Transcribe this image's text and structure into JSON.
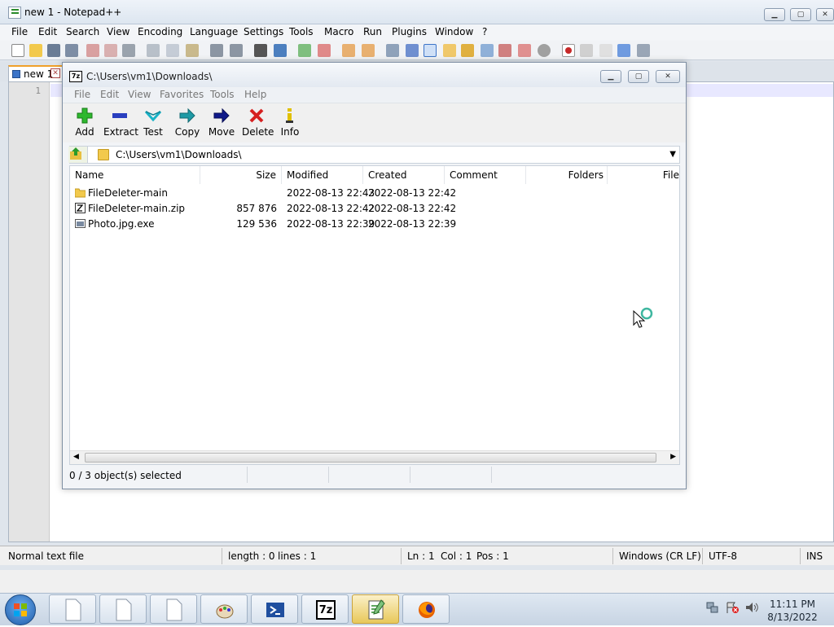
{
  "npp": {
    "title": "new 1 - Notepad++",
    "menu": [
      "File",
      "Edit",
      "Search",
      "View",
      "Encoding",
      "Language",
      "Settings",
      "Tools",
      "Macro",
      "Run",
      "Plugins",
      "Window",
      "?"
    ],
    "tab_label": "new 1",
    "line_number": "1",
    "status": {
      "type": "Normal text file",
      "length": "length : 0",
      "lines": "lines : 1",
      "ln": "Ln : 1",
      "col": "Col : 1",
      "pos": "Pos : 1",
      "eol": "Windows (CR LF)",
      "encoding": "UTF-8",
      "mode": "INS"
    }
  },
  "sevenzip": {
    "title": "C:\\Users\\vm1\\Downloads\\",
    "icon_text": "7z",
    "menu": [
      "File",
      "Edit",
      "View",
      "Favorites",
      "Tools",
      "Help"
    ],
    "toolbar": {
      "add": "Add",
      "extract": "Extract",
      "test": "Test",
      "copy": "Copy",
      "move": "Move",
      "delete": "Delete",
      "info": "Info"
    },
    "address": "C:\\Users\\vm1\\Downloads\\",
    "columns": [
      "Name",
      "Size",
      "Modified",
      "Created",
      "Comment",
      "Folders",
      "File"
    ],
    "files": [
      {
        "name": "FileDeleter-main",
        "size": "",
        "modified": "2022-08-13 22:43",
        "created": "2022-08-13 22:42",
        "type": "folder"
      },
      {
        "name": "FileDeleter-main.zip",
        "size": "857 876",
        "modified": "2022-08-13 22:42",
        "created": "2022-08-13 22:42",
        "type": "zip"
      },
      {
        "name": "Photo.jpg.exe",
        "size": "129 536",
        "modified": "2022-08-13 22:39",
        "created": "2022-08-13 22:39",
        "type": "exe"
      }
    ],
    "status": "0 / 3 object(s) selected"
  },
  "taskbar": {
    "time": "11:11 PM",
    "date": "8/13/2022",
    "sevenzip_label": "7z",
    "apps": [
      "file-icon",
      "file-icon",
      "file-icon",
      "paint-icon",
      "powershell-icon",
      "7zip-icon",
      "notepadpp-icon",
      "firefox-icon"
    ]
  },
  "colors": {
    "accent": "#3c74c8",
    "selected_tab": "#f0a02a",
    "active_taskbar": "#e8c85a"
  }
}
